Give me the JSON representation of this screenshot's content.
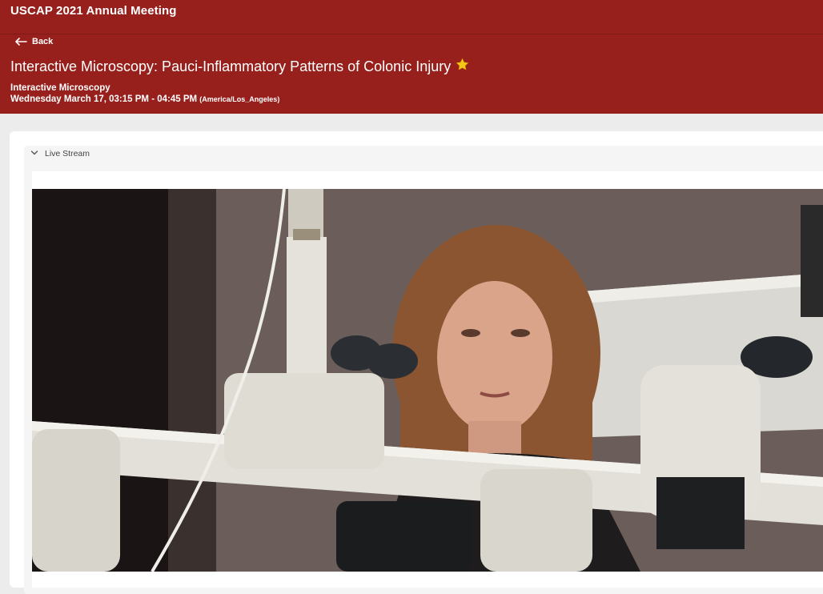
{
  "app": {
    "title": "USCAP 2021 Annual Meeting"
  },
  "nav": {
    "back_label": "Back"
  },
  "session": {
    "title": "Interactive Microscopy: Pauci-Inflammatory Patterns of Colonic Injury",
    "favorite_icon": "star-icon",
    "type": "Interactive Microscopy",
    "datetime": "Wednesday March 17, 03:15 PM - 04:45 PM",
    "timezone": "(America/Los_Angeles)"
  },
  "stream": {
    "section_label": "Live Stream",
    "toggle_icon": "chevron-down-icon"
  },
  "colors": {
    "header_bg": "#97201c",
    "star": "#f5c518",
    "page_bg": "#ececec"
  }
}
